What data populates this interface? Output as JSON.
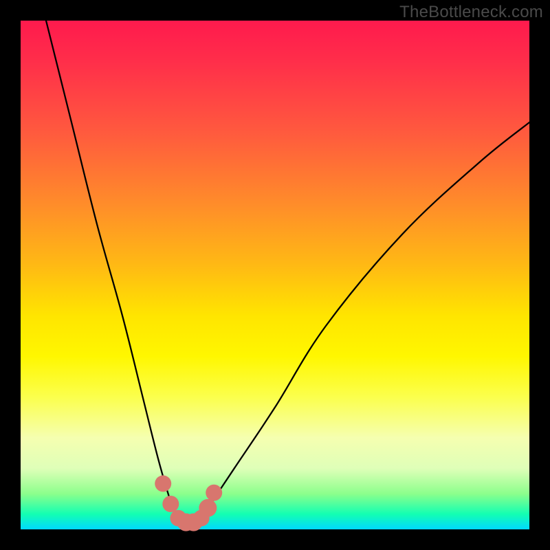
{
  "watermark": "TheBottleneck.com",
  "chart_data": {
    "type": "line",
    "title": "",
    "xlabel": "",
    "ylabel": "",
    "xlim": [
      0,
      100
    ],
    "ylim": [
      0,
      100
    ],
    "series": [
      {
        "name": "bottleneck-curve",
        "x": [
          5,
          10,
          15,
          20,
          24,
          27,
          29,
          30,
          31,
          32,
          33,
          34,
          35,
          36,
          38,
          42,
          50,
          60,
          75,
          90,
          100
        ],
        "values": [
          100,
          80,
          60,
          42,
          26,
          14,
          7,
          4,
          2,
          1,
          1,
          1,
          2,
          3,
          6,
          12,
          24,
          40,
          58,
          72,
          80
        ]
      }
    ],
    "markers": {
      "name": "highlight-points",
      "x": [
        28,
        29.5,
        31,
        32.5,
        34,
        35.5,
        36.8,
        38
      ],
      "values": [
        9,
        5,
        2.2,
        1.4,
        1.4,
        2.2,
        4.2,
        7.2
      ],
      "radius": [
        12,
        12,
        12,
        13,
        13,
        12,
        13,
        12
      ]
    },
    "background_gradient": {
      "top_color": "#ff1a4d",
      "mid_color": "#ffe500",
      "bottom_color": "#00d9ff"
    }
  }
}
